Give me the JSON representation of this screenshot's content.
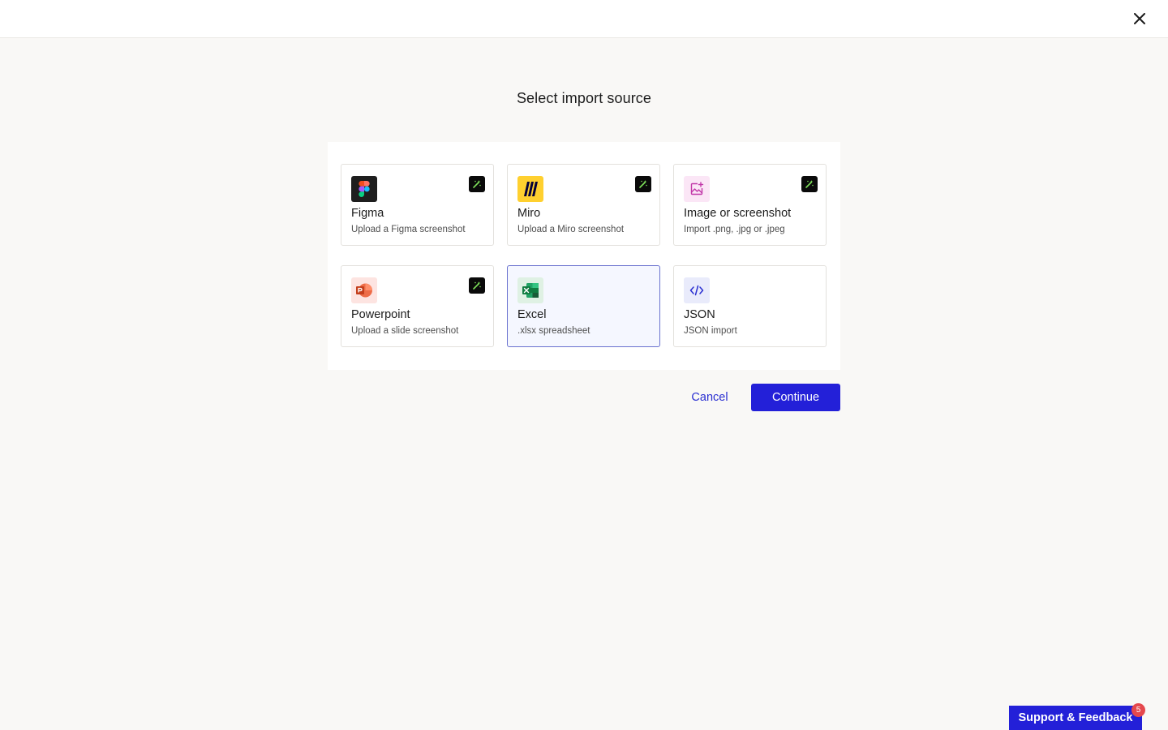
{
  "header": {
    "close_icon": "close-icon"
  },
  "dialog": {
    "title": "Select import source",
    "sources": [
      {
        "name": "Figma",
        "description": "Upload a Figma screenshot",
        "icon": "figma-icon",
        "ai": true,
        "selected": false
      },
      {
        "name": "Miro",
        "description": "Upload a Miro screenshot",
        "icon": "miro-icon",
        "ai": true,
        "selected": false
      },
      {
        "name": "Image or screenshot",
        "description": "Import .png, .jpg or .jpeg",
        "icon": "image-icon",
        "ai": true,
        "selected": false
      },
      {
        "name": "Powerpoint",
        "description": "Upload a slide screenshot",
        "icon": "powerpoint-icon",
        "ai": true,
        "selected": false
      },
      {
        "name": "Excel",
        "description": ".xlsx spreadsheet",
        "icon": "excel-icon",
        "ai": false,
        "selected": true
      },
      {
        "name": "JSON",
        "description": "JSON import",
        "icon": "code-icon",
        "ai": false,
        "selected": false
      }
    ],
    "cancel_label": "Cancel",
    "continue_label": "Continue"
  },
  "support": {
    "label": "Support & Feedback",
    "badge_count": "5"
  },
  "colors": {
    "accent": "#2320d8",
    "selected_border": "#6a72cf",
    "selected_bg": "#f5f7ff",
    "ai_badge_bg": "#0a0a0a",
    "ai_badge_fg": "#7ee05a",
    "badge_red": "#e5484d"
  }
}
